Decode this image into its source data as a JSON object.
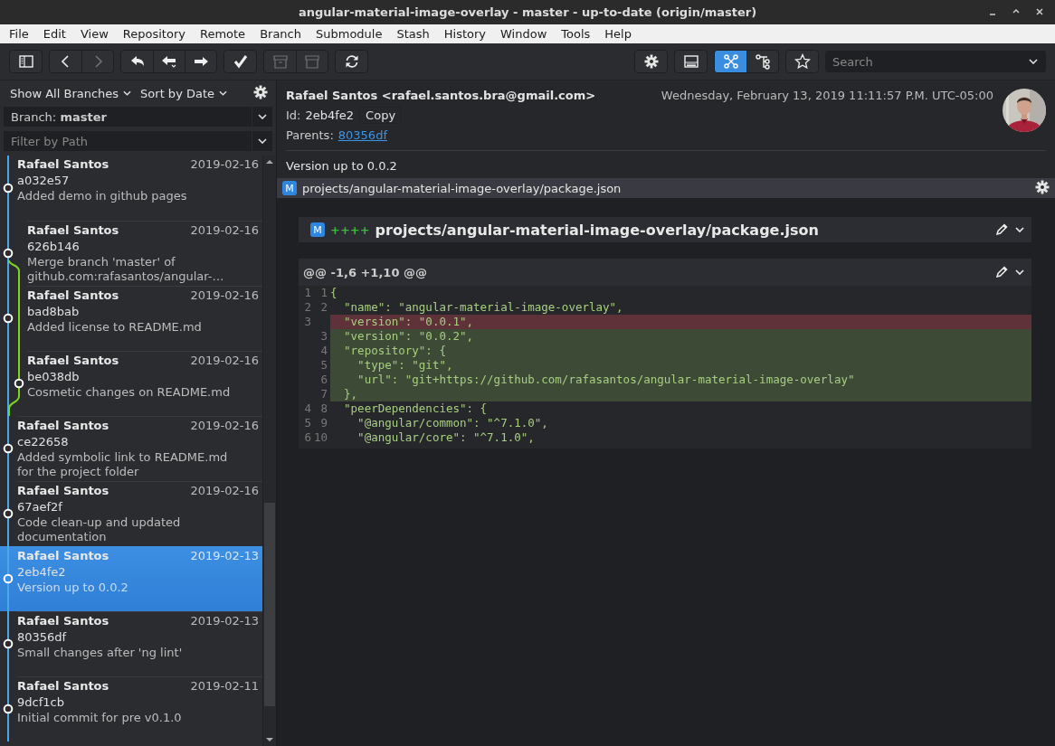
{
  "window": {
    "title": "angular-material-image-overlay - master - up-to-date (origin/master)"
  },
  "menu": [
    "File",
    "Edit",
    "View",
    "Repository",
    "Remote",
    "Branch",
    "Submodule",
    "Stash",
    "History",
    "Window",
    "Tools",
    "Help"
  ],
  "toolbar_left": [
    [
      {
        "kind": "sidebar",
        "disabled": false
      }
    ],
    [
      {
        "kind": "back",
        "disabled": false
      },
      {
        "kind": "forward",
        "disabled": true
      }
    ],
    [
      {
        "kind": "undo",
        "disabled": false
      },
      {
        "kind": "pull",
        "disabled": false
      },
      {
        "kind": "push",
        "disabled": false
      }
    ],
    [
      {
        "kind": "commit",
        "disabled": false
      }
    ],
    [
      {
        "kind": "stash",
        "disabled": true
      },
      {
        "kind": "pop",
        "disabled": true
      }
    ],
    [
      {
        "kind": "refresh",
        "disabled": false
      }
    ]
  ],
  "toolbar_right": [
    [
      {
        "kind": "settings",
        "selected": false
      }
    ],
    [
      {
        "kind": "layout",
        "selected": false
      }
    ],
    [
      {
        "kind": "graph",
        "selected": true
      },
      {
        "kind": "tree",
        "selected": false
      }
    ],
    [
      {
        "kind": "star",
        "selected": false
      }
    ]
  ],
  "search": {
    "placeholder": "Search"
  },
  "sidebar": {
    "branch_filter": "Show All Branches",
    "sort": "Sort by Date",
    "branch_field": "Branch: **master**",
    "path_placeholder": "Filter by Path"
  },
  "commits": [
    {
      "author": "Rafael Santos",
      "date": "2019-02-16",
      "hash": "a032e57",
      "message": "Added demo in github pages",
      "kind": "main",
      "selected": false
    },
    {
      "author": "Rafael Santos",
      "date": "2019-02-16",
      "hash": "626b146",
      "message": "Merge branch 'master' of github.com:rafasantos/angular-…",
      "kind": "merge",
      "selected": false
    },
    {
      "author": "Rafael Santos",
      "date": "2019-02-16",
      "hash": "bad8bab",
      "message": "Added license to README.md",
      "kind": "side",
      "selected": false
    },
    {
      "author": "Rafael Santos",
      "date": "2019-02-16",
      "hash": "be038db",
      "message": "Cosmetic changes on README.md",
      "kind": "branch",
      "selected": false
    },
    {
      "author": "Rafael Santos",
      "date": "2019-02-16",
      "hash": "ce22658",
      "message": "Added symbolic link to README.md for the project folder",
      "kind": "main",
      "selected": false
    },
    {
      "author": "Rafael Santos",
      "date": "2019-02-16",
      "hash": "67aef2f",
      "message": "Code clean-up and updated documentation",
      "kind": "main",
      "selected": false
    },
    {
      "author": "Rafael Santos",
      "date": "2019-02-13",
      "hash": "2eb4fe2",
      "message": "Version up to 0.0.2",
      "kind": "main",
      "selected": true
    },
    {
      "author": "Rafael Santos",
      "date": "2019-02-13",
      "hash": "80356df",
      "message": "Small changes after 'ng lint'",
      "kind": "main",
      "selected": false
    },
    {
      "author": "Rafael Santos",
      "date": "2019-02-11",
      "hash": "9dcf1cb",
      "message": "Initial commit for pre v0.1.0",
      "kind": "main",
      "selected": false
    }
  ],
  "detail": {
    "author": "Rafael Santos <rafael.santos.bra@gmail.com>",
    "date": "Wednesday, February 13, 2019 11:11:57 P.M. UTC-05:00",
    "id_label": "Id:",
    "id": "2eb4fe2",
    "copy": "Copy",
    "parents_label": "Parents:",
    "parent": "80356df",
    "message": "Version up to 0.0.2"
  },
  "file_bar": {
    "status": "M",
    "path": "projects/angular-material-image-overlay/package.json"
  },
  "diff": {
    "status": "M",
    "marker": "++++",
    "path": "projects/angular-material-image-overlay/package.json",
    "hunk": "@@ -1,6 +1,10 @@",
    "lines": [
      {
        "old": "1",
        "new": "1",
        "kind": "context",
        "text": "{"
      },
      {
        "old": "2",
        "new": "2",
        "kind": "context",
        "text": "  \"name\": \"angular-material-image-overlay\","
      },
      {
        "old": "3",
        "kind": "removed",
        "text": "  \"version\": \"0.0.1\","
      },
      {
        "new": "3",
        "kind": "added",
        "text": "  \"version\": \"0.0.2\","
      },
      {
        "new": "4",
        "kind": "added",
        "text": "  \"repository\": {"
      },
      {
        "new": "5",
        "kind": "added",
        "text": "    \"type\": \"git\","
      },
      {
        "new": "6",
        "kind": "added",
        "text": "    \"url\": \"git+https://github.com/rafasantos/angular-material-image-overlay\""
      },
      {
        "new": "7",
        "kind": "added",
        "text": "  },"
      },
      {
        "old": "4",
        "new": "8",
        "kind": "context",
        "text": "  \"peerDependencies\": {"
      },
      {
        "old": "5",
        "new": "9",
        "kind": "context",
        "text": "    \"@angular/common\": \"^7.1.0\","
      },
      {
        "old": "6",
        "new": "10",
        "kind": "context",
        "text": "    \"@angular/core\": \"^7.1.0\","
      }
    ]
  }
}
